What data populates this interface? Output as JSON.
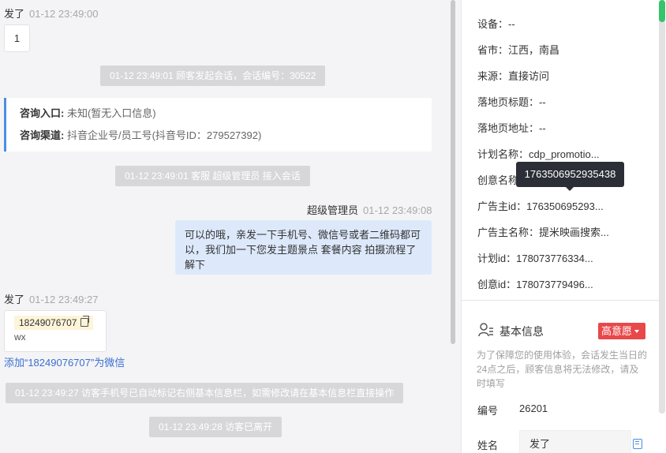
{
  "colors": {
    "accent_blue": "#4a90e2",
    "intent_red": "#e8484a",
    "scroll_green": "#35c46a",
    "agent_bubble": "#dde9fb"
  },
  "chat": {
    "visitor_name": "发了",
    "msg1_time": "01-12 23:49:00",
    "msg1_text": "1",
    "sys_session_start": "01-12 23:49:01 顾客发起会话，会话编号：30522",
    "consult": {
      "entry_label": "咨询入口:",
      "entry_value": "未知(暂无入口信息)",
      "channel_label": "咨询渠道:",
      "channel_value": "抖音企业号/员工号(抖音号ID：279527392)"
    },
    "sys_agent_join": "01-12 23:49:01 客服 超级管理员 接入会话",
    "agent_name": "超级管理员",
    "agent_time": "01-12 23:49:08",
    "agent_text": "可以的哦，亲发一下手机号、微信号或者二维码都可以，我们加一下您发主题景点 套餐内容 拍摄流程了解下",
    "msg2_time": "01-12 23:49:27",
    "phone_number": "18249076707",
    "phone_sub": "wx",
    "copy_icon": "copy-icon",
    "add_wechat_link": "添加“18249076707”为微信",
    "sys_phone_marked": "01-12 23:49:27 访客手机号已自动标记右侧基本信息栏，如需修改请在基本信息栏直接操作",
    "sys_visitor_left": "01-12 23:49:28 访客已离开"
  },
  "info": {
    "device": "设备：--",
    "province_city": "省市：江西，南昌",
    "source": "来源：直接访问",
    "landing_title": "落地页标题：--",
    "landing_url": "落地页地址：--",
    "plan_name": "计划名称：cdp_promotio...",
    "creative_name": "创意名称：",
    "advertiser_id": "广告主id：176350695293...",
    "advertiser_name": "广告主名称：提米映画搜索...",
    "plan_id": "计划id：178073776334...",
    "creative_id": "创意id：178073779496...",
    "tooltip": "1763506952935438"
  },
  "basic_info": {
    "icon": "person-list-icon",
    "title": "基本信息",
    "intent_badge": "高意愿",
    "notice": "为了保障您的使用体验，会话发生当日的24点之后，顾客信息将无法修改，请及时填写",
    "number_label": "编号",
    "number_value": "26201",
    "name_label": "姓名",
    "name_value": "发了"
  }
}
